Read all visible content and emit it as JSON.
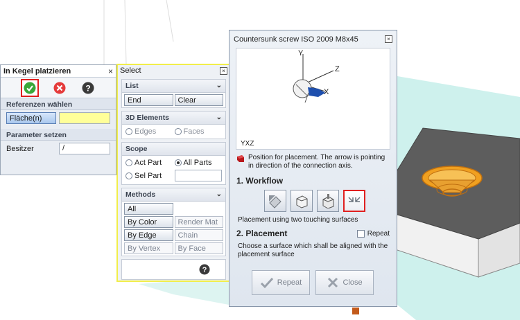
{
  "panel_cone": {
    "title": "In Kegel platzieren",
    "close_glyph": "×",
    "toolbar": {
      "ok_icon": "check-icon",
      "cancel_icon": "cancel-icon",
      "help_icon": "help-icon"
    },
    "section_references": "Referenzen wählen",
    "reference_button": "Fläche(n)",
    "reference_value": "",
    "section_parameters": "Parameter setzen",
    "owner_label": "Besitzer",
    "owner_value": "/"
  },
  "panel_select": {
    "title": "Select",
    "close_glyph": "×",
    "list": {
      "header": "List",
      "end": "End",
      "clear": "Clear"
    },
    "elements": {
      "header": "3D Elements",
      "edges": "Edges",
      "faces": "Faces"
    },
    "scope": {
      "header": "Scope",
      "act_part": "Act Part",
      "all_parts": "All Parts",
      "sel_part": "Sel Part",
      "sel_value": "",
      "selected": "all_parts"
    },
    "methods": {
      "header": "Methods",
      "all": "All",
      "by_color": "By Color",
      "render_mat": "Render Mat",
      "by_edge": "By Edge",
      "chain": "Chain",
      "by_vertex": "By Vertex",
      "by_face": "By Face"
    },
    "help_icon": "help-icon"
  },
  "panel_screw": {
    "title": "Countersunk screw ISO 2009 M8x45",
    "close_glyph": "×",
    "preview_axes": {
      "y": "Y",
      "z": "Z",
      "x": "X",
      "corner": "YXZ"
    },
    "note": "Position for placement. The arrow is pointing in direction of the connection axis.",
    "workflow_header": "1. Workflow",
    "workflow_desc": "Placement using two touching surfaces",
    "placement_header": "2. Placement",
    "repeat_check_label": "Repeat",
    "placement_desc": "Choose a surface which shall be aligned with the placement surface",
    "repeat_button": "Repeat",
    "close_button": "Close"
  },
  "colors": {
    "highlight_red": "#e02020",
    "select_border": "#f1ee4a",
    "field_yellow": "#ffff99",
    "cone_orange": "#f0a020",
    "block_top": "#5a5a5a",
    "block_side": "#eeeeee",
    "plane": "#c6eeea"
  }
}
